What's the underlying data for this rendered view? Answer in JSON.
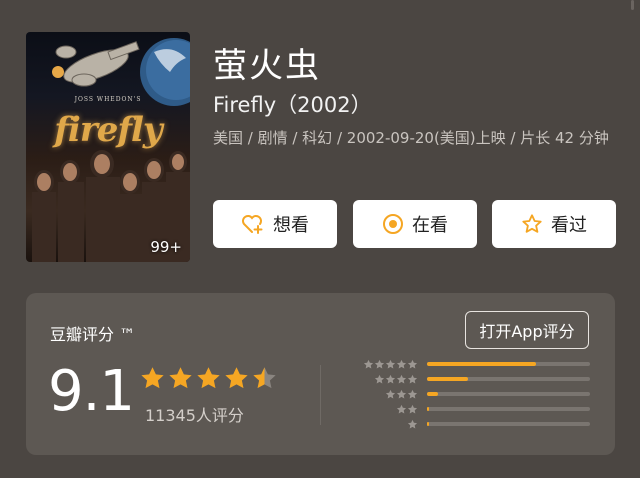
{
  "movie": {
    "title_cn": "萤火虫",
    "title_en": "Firefly（2002）",
    "meta": "美国 / 剧情 / 科幻 / 2002-09-20(美国)上映 / 片长 42 分钟",
    "poster": {
      "credit": "JOSS WHEDON'S",
      "title": "firefly",
      "badge": "99+"
    }
  },
  "actions": [
    {
      "label": "想看",
      "icon": "heart-plus-icon"
    },
    {
      "label": "在看",
      "icon": "target-circle-icon"
    },
    {
      "label": "看过",
      "icon": "star-outline-icon"
    }
  ],
  "rating": {
    "source": "豆瓣评分 ™",
    "rate_app_label": "打开App评分",
    "score": "9.1",
    "stars": 4.5,
    "count_text": "11345人评分",
    "distribution": [
      {
        "stars": 5,
        "fraction": 0.67
      },
      {
        "stars": 4,
        "fraction": 0.25
      },
      {
        "stars": 3,
        "fraction": 0.07
      },
      {
        "stars": 2,
        "fraction": 0.01
      },
      {
        "stars": 1,
        "fraction": 0.01
      }
    ]
  },
  "colors": {
    "background": "#4b4642",
    "card": "#5d5853",
    "accent": "#f5a623",
    "button_bg": "#ffffff"
  }
}
